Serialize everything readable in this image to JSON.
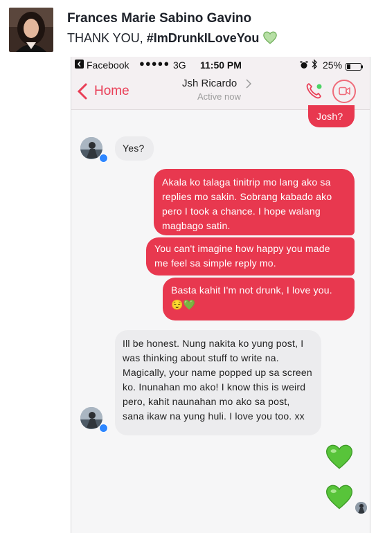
{
  "post": {
    "author": "Frances Marie Sabino Gavino",
    "text_prefix": "THANK YOU, ",
    "hashtag": "#ImDrunkILoveYou",
    "heart_icon": "green-heart-emoji"
  },
  "status_bar": {
    "app": "Facebook",
    "signal": "●●●●●",
    "network": "3G",
    "time": "11:50 PM",
    "battery": "25%"
  },
  "chat_header": {
    "back_label": "Home",
    "contact_name": "Jsh Ricardo",
    "status": "Active now"
  },
  "messages": {
    "m1": "Josh?",
    "m2": "Yes?",
    "m3": "Akala ko talaga tinitrip mo lang ako sa replies mo sakin. Sobrang kabado ako pero I took a chance. I hope walang magbago satin.",
    "m4": "You can't imagine how happy you made me feel sa simple reply mo.",
    "m5": "Basta kahit I'm not drunk, I love you.",
    "m5_emoji": "😌💚",
    "m6": "Ill be honest. Nung nakita ko yung post, I was thinking about stuff to write na. Magically, your name popped up sa screen ko. Inunahan mo ako! I know this is weird pero, kahit naunahan mo ako sa post, sana ikaw na yung huli. I love you too. xx"
  },
  "colors": {
    "outgoing": "#e8384f",
    "incoming": "#ececee",
    "accent": "#e93f57",
    "heart_green": "#58c43a"
  }
}
